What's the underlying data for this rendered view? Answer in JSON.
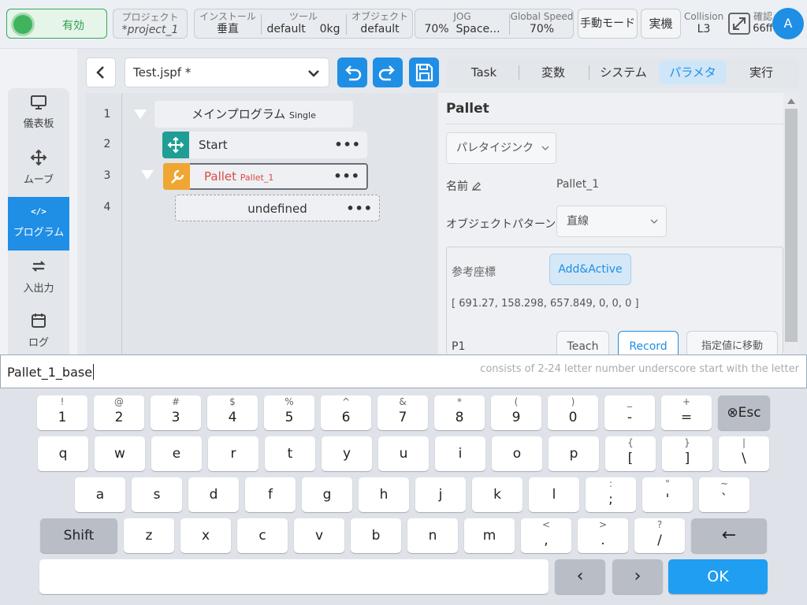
{
  "topbar": {
    "enable_label": "有効",
    "project": {
      "label": "プロジェクト",
      "value": "*project_1"
    },
    "install": {
      "label": "インストール",
      "value": "垂直"
    },
    "tool": {
      "label": "ツール",
      "value": "default",
      "weight": "0kg"
    },
    "object": {
      "label": "オブジェクト",
      "value": "default"
    },
    "jog": {
      "label": "JOG",
      "value": "70%",
      "space": "Space..."
    },
    "global_speed": {
      "label": "Global Speed",
      "value": "70%"
    },
    "manual_mode": "手動モード",
    "real_machine": "実機",
    "collision": {
      "label": "Collision",
      "value": "L3"
    },
    "confirm": {
      "label": "確認",
      "value": "66ff"
    },
    "avatar": "A"
  },
  "leftnav": [
    {
      "label": "儀表板",
      "icon": "monitor-icon"
    },
    {
      "label": "ムーブ",
      "icon": "move-icon"
    },
    {
      "label": "プログラム",
      "icon": "code-icon"
    },
    {
      "label": "入出力",
      "icon": "io-icon"
    },
    {
      "label": "ログ",
      "icon": "calendar-icon"
    }
  ],
  "file": {
    "name": "Test.jspf *"
  },
  "tree": {
    "line_numbers": [
      "1",
      "2",
      "3",
      "4"
    ],
    "main": {
      "title": "メインプログラム",
      "mode": "Single"
    },
    "start": "Start",
    "pallet": {
      "title": "Pallet",
      "name": "Pallet_1"
    },
    "undefined": "undefined"
  },
  "tabs": [
    "Task",
    "変数",
    "システム",
    "パラメタ",
    "実行"
  ],
  "panel": {
    "title": "Pallet",
    "type_select": "パレタイジンク",
    "name_label": "名前",
    "name_value": "Pallet_1",
    "pattern_label": "オブジェクトパターン",
    "pattern_value": "直線",
    "ref_label": "参考座標",
    "add_active": "Add&Active",
    "coords": "[ 691.27, 158.298, 657.849, 0, 0, 0 ]",
    "p1_label": "P1",
    "teach": "Teach",
    "record": "Record",
    "move_to": "指定値に移動"
  },
  "input": {
    "value": "Pallet_1_base",
    "hint": "consists of 2-24 letter number underscore start with the letter"
  },
  "keyboard": {
    "row1": [
      [
        "!",
        "1"
      ],
      [
        "@",
        "2"
      ],
      [
        "#",
        "3"
      ],
      [
        "$",
        "4"
      ],
      [
        "%",
        "5"
      ],
      [
        "^",
        "6"
      ],
      [
        "&",
        "7"
      ],
      [
        "*",
        "8"
      ],
      [
        "(",
        "9"
      ],
      [
        ")",
        "0"
      ],
      [
        "_",
        "-"
      ],
      [
        "+",
        "="
      ]
    ],
    "esc": "⊗Esc",
    "row2": [
      [
        "",
        "q"
      ],
      [
        "",
        "w"
      ],
      [
        "",
        "e"
      ],
      [
        "",
        "r"
      ],
      [
        "",
        "t"
      ],
      [
        "",
        "y"
      ],
      [
        "",
        "u"
      ],
      [
        "",
        "i"
      ],
      [
        "",
        "o"
      ],
      [
        "",
        "p"
      ],
      [
        "{",
        "["
      ],
      [
        "}",
        "]"
      ],
      [
        "|",
        "\\"
      ]
    ],
    "row3": [
      [
        "",
        "a"
      ],
      [
        "",
        "s"
      ],
      [
        "",
        "d"
      ],
      [
        "",
        "f"
      ],
      [
        "",
        "g"
      ],
      [
        "",
        "h"
      ],
      [
        "",
        "j"
      ],
      [
        "",
        "k"
      ],
      [
        "",
        "l"
      ],
      [
        ":",
        ";"
      ],
      [
        "\"",
        "'"
      ],
      [
        "~",
        "`"
      ]
    ],
    "shift": "Shift",
    "row4": [
      [
        "",
        "z"
      ],
      [
        "",
        "x"
      ],
      [
        "",
        "c"
      ],
      [
        "",
        "v"
      ],
      [
        "",
        "b"
      ],
      [
        "",
        "n"
      ],
      [
        "",
        "m"
      ],
      [
        "<",
        ","
      ],
      [
        ">",
        "."
      ],
      [
        "?",
        "/"
      ]
    ],
    "backspace": "←",
    "left": "‹",
    "right": "›",
    "ok": "OK"
  }
}
